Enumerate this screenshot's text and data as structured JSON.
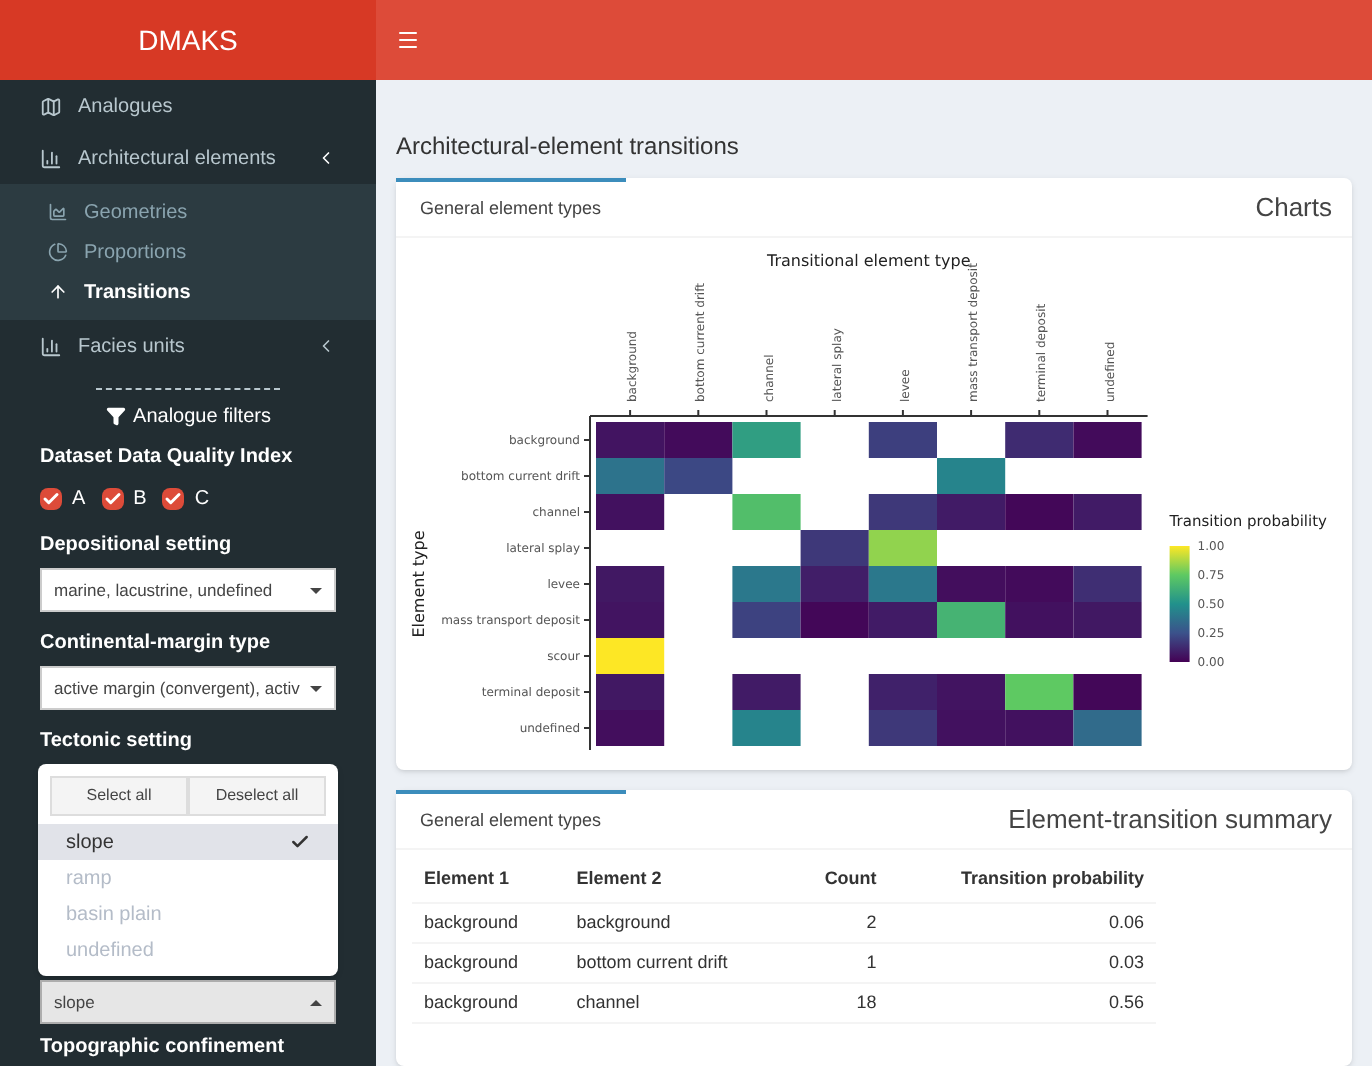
{
  "header": {
    "logo": "DMAKS"
  },
  "sidebar": {
    "menu": [
      {
        "label": "Analogues",
        "selected": false
      },
      {
        "label": "Architectural elements",
        "selected": false,
        "expanded": true,
        "children": [
          {
            "label": "Geometries",
            "selected": false
          },
          {
            "label": "Proportions",
            "selected": false
          },
          {
            "label": "Transitions",
            "selected": true
          }
        ]
      },
      {
        "label": "Facies units",
        "selected": false,
        "expanded": false
      }
    ],
    "filters_title": "Analogue filters",
    "quality": {
      "label": "Dataset Data Quality Index",
      "options": [
        {
          "label": "A",
          "checked": true
        },
        {
          "label": "B",
          "checked": true
        },
        {
          "label": "C",
          "checked": true
        }
      ]
    },
    "selects": [
      {
        "label": "Depositional setting",
        "value": "marine, lacustrine, undefined",
        "open": false
      },
      {
        "label": "Continental-margin type",
        "value": "active margin (convergent), activ",
        "open": false
      },
      {
        "label": "Tectonic setting",
        "value": "slope",
        "open": true,
        "actions": [
          "Select all",
          "Deselect all"
        ],
        "options": [
          {
            "label": "slope",
            "selected": true
          },
          {
            "label": "ramp",
            "selected": false
          },
          {
            "label": "basin plain",
            "selected": false
          },
          {
            "label": "undefined",
            "selected": false
          }
        ]
      }
    ],
    "next_label": "Topographic confinement"
  },
  "page_title": "Architectural-element transitions",
  "charts_box": {
    "tabs": [
      {
        "label": "General element types",
        "selected": true
      }
    ],
    "title": "Charts",
    "heatmap": {
      "title": "Transitional element type",
      "ylabel": "Element type",
      "columns": [
        "background",
        "bottom current drift",
        "channel",
        "lateral splay",
        "levee",
        "mass transport deposit",
        "terminal deposit",
        "undefined"
      ],
      "rows": [
        {
          "label": "background",
          "cells": [
            {
              "kind": "filled",
              "color": "#421461"
            },
            {
              "kind": "filled",
              "color": "#430b5b"
            },
            {
              "kind": "filled",
              "color": "#309e82"
            },
            {
              "kind": "empty"
            },
            {
              "kind": "filled",
              "color": "#3d3f7e"
            },
            {
              "kind": "empty"
            },
            {
              "kind": "filled",
              "color": "#3f2b71"
            },
            {
              "kind": "filled",
              "color": "#430b5b"
            }
          ]
        },
        {
          "label": "bottom current drift",
          "cells": [
            {
              "kind": "filled",
              "color": "#2d738c"
            },
            {
              "kind": "filled",
              "color": "#3c4884"
            },
            {
              "kind": "empty"
            },
            {
              "kind": "empty"
            },
            {
              "kind": "empty"
            },
            {
              "kind": "filled",
              "color": "#26848c"
            },
            {
              "kind": "empty"
            },
            {
              "kind": "empty"
            }
          ]
        },
        {
          "label": "channel",
          "cells": [
            {
              "kind": "filled",
              "color": "#42115f"
            },
            {
              "kind": "empty"
            },
            {
              "kind": "filled",
              "color": "#52be6a"
            },
            {
              "kind": "empty"
            },
            {
              "kind": "filled",
              "color": "#3e3879"
            },
            {
              "kind": "filled",
              "color": "#411b66"
            },
            {
              "kind": "filled",
              "color": "#430758"
            },
            {
              "kind": "filled",
              "color": "#411b66"
            }
          ]
        },
        {
          "label": "lateral splay",
          "cells": [
            {
              "kind": "empty"
            },
            {
              "kind": "empty"
            },
            {
              "kind": "empty"
            },
            {
              "kind": "filled",
              "color": "#3e3879"
            },
            {
              "kind": "filled",
              "color": "#91d34e"
            },
            {
              "kind": "empty"
            },
            {
              "kind": "empty"
            },
            {
              "kind": "empty"
            }
          ]
        },
        {
          "label": "levee",
          "cells": [
            {
              "kind": "filled",
              "color": "#411863"
            },
            {
              "kind": "empty"
            },
            {
              "kind": "filled",
              "color": "#2b788c"
            },
            {
              "kind": "filled",
              "color": "#411e68"
            },
            {
              "kind": "filled",
              "color": "#2b788c"
            },
            {
              "kind": "filled",
              "color": "#430e5d"
            },
            {
              "kind": "filled",
              "color": "#430b5b"
            },
            {
              "kind": "filled",
              "color": "#3f2e73"
            }
          ]
        },
        {
          "label": "mass transport deposit",
          "cells": [
            {
              "kind": "filled",
              "color": "#421461"
            },
            {
              "kind": "empty"
            },
            {
              "kind": "filled",
              "color": "#3d4280"
            },
            {
              "kind": "filled",
              "color": "#430758"
            },
            {
              "kind": "filled",
              "color": "#411b66"
            },
            {
              "kind": "filled",
              "color": "#46b373"
            },
            {
              "kind": "filled",
              "color": "#42115f"
            },
            {
              "kind": "filled",
              "color": "#411863"
            }
          ]
        },
        {
          "label": "scour",
          "cells": [
            {
              "kind": "filled",
              "color": "#fde725"
            },
            {
              "kind": "empty"
            },
            {
              "kind": "empty"
            },
            {
              "kind": "empty"
            },
            {
              "kind": "empty"
            },
            {
              "kind": "empty"
            },
            {
              "kind": "empty"
            },
            {
              "kind": "empty"
            }
          ]
        },
        {
          "label": "terminal deposit",
          "cells": [
            {
              "kind": "filled",
              "color": "#411863"
            },
            {
              "kind": "empty"
            },
            {
              "kind": "filled",
              "color": "#411b66"
            },
            {
              "kind": "empty"
            },
            {
              "kind": "filled",
              "color": "#40216a"
            },
            {
              "kind": "filled",
              "color": "#421461"
            },
            {
              "kind": "filled",
              "color": "#5ec962"
            },
            {
              "kind": "filled",
              "color": "#430758"
            }
          ]
        },
        {
          "label": "undefined",
          "cells": [
            {
              "kind": "filled",
              "color": "#430e5d"
            },
            {
              "kind": "empty"
            },
            {
              "kind": "filled",
              "color": "#26848c"
            },
            {
              "kind": "empty"
            },
            {
              "kind": "filled",
              "color": "#3e3879"
            },
            {
              "kind": "filled",
              "color": "#42115f"
            },
            {
              "kind": "filled",
              "color": "#42115f"
            },
            {
              "kind": "filled",
              "color": "#316b8b"
            }
          ]
        }
      ],
      "legend": {
        "title": "Transition probability",
        "ticks": [
          "1.00",
          "0.75",
          "0.50",
          "0.25",
          "0.00"
        ]
      }
    }
  },
  "summary_box": {
    "tabs": [
      {
        "label": "General element types",
        "selected": true
      }
    ],
    "title": "Element-transition summary",
    "table": {
      "columns": [
        "Element 1",
        "Element 2",
        "Count",
        "Transition probability"
      ],
      "rows": [
        [
          "background",
          "background",
          "2",
          "0.06"
        ],
        [
          "background",
          "bottom current drift",
          "1",
          "0.03"
        ],
        [
          "background",
          "channel",
          "18",
          "0.56"
        ]
      ]
    }
  }
}
